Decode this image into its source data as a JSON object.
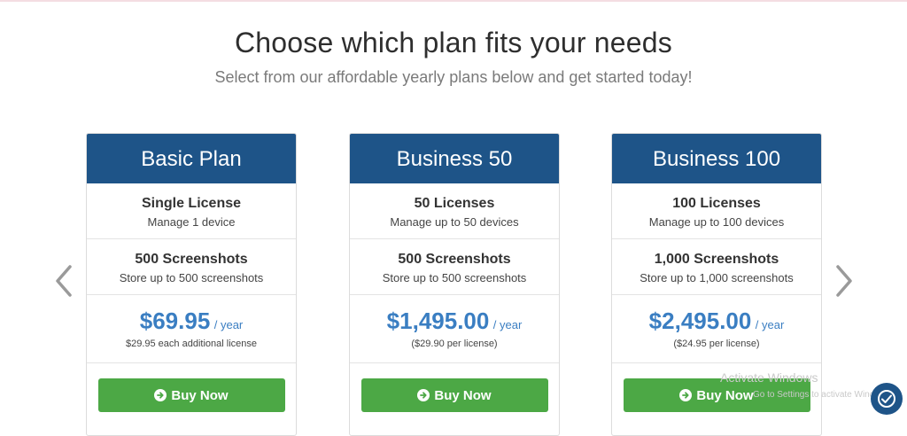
{
  "header": {
    "title": "Choose which plan fits your needs",
    "subtitle": "Select from our affordable yearly plans below and get started today!"
  },
  "plans": [
    {
      "name": "Basic Plan",
      "licenses_title": "Single License",
      "licenses_desc": "Manage 1 device",
      "screenshots_title": "500 Screenshots",
      "screenshots_desc": "Store up to 500 screenshots",
      "price": "$69.95",
      "period": "/ year",
      "price_note": "$29.95 each additional license",
      "button_label": "Buy Now"
    },
    {
      "name": "Business 50",
      "licenses_title": "50 Licenses",
      "licenses_desc": "Manage up to 50 devices",
      "screenshots_title": "500 Screenshots",
      "screenshots_desc": "Store up to 500 screenshots",
      "price": "$1,495.00",
      "period": "/ year",
      "price_note": "($29.90 per license)",
      "button_label": "Buy Now"
    },
    {
      "name": "Business 100",
      "licenses_title": "100 Licenses",
      "licenses_desc": "Manage up to 100 devices",
      "screenshots_title": "1,000 Screenshots",
      "screenshots_desc": "Store up to 1,000 screenshots",
      "price": "$2,495.00",
      "period": "/ year",
      "price_note": "($24.95 per license)",
      "button_label": "Buy Now"
    }
  ],
  "carousel": {
    "prev_icon": "chevron-left-icon",
    "next_icon": "chevron-right-icon"
  },
  "watermark": {
    "line1": "Activate Windows",
    "line2": "Go to Settings to activate Windows."
  },
  "help_widget": {
    "icon": "help-chat-icon"
  },
  "colors": {
    "header_blue": "#1e5488",
    "price_blue": "#3a7ec2",
    "button_green": "#4ca845"
  }
}
